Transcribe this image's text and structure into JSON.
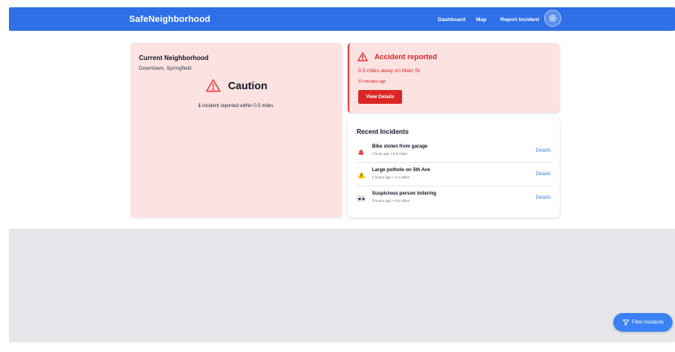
{
  "nav": {
    "brand": "SafeNeighborhood",
    "links": [
      {
        "label": "Dashboard"
      },
      {
        "label": "Map"
      },
      {
        "label": "Report Incident"
      }
    ],
    "avatar_icon": "settings-icon"
  },
  "neighborhood": {
    "title": "Current Neighborhood",
    "location": "Downtown, Springfield",
    "status_icon": "warning-triangle-icon",
    "status_label": "Caution",
    "summary_count": "1",
    "summary_text": " incident reported within 0.5 miles."
  },
  "alert": {
    "icon": "warning-triangle-icon",
    "title": "Accident reported",
    "distance": "0.5 miles away on Main St.",
    "time": "10 minutes ago",
    "button_label": "View Details"
  },
  "recent": {
    "title": "Recent Incidents",
    "items": [
      {
        "icon": "siren-icon",
        "title": "Bike stolen from garage",
        "meta": "1 hour ago • 0.8 miles",
        "link": "Details"
      },
      {
        "icon": "warning-icon",
        "title": "Large pothole on 5th Ave",
        "meta": "2 hours ago • 1.2 miles",
        "link": "Details"
      },
      {
        "icon": "eyes-icon",
        "title": "Suspicious person loitering",
        "meta": "3 hours ago • 0.5 miles",
        "link": "Details"
      }
    ]
  },
  "filter": {
    "icon": "filter-icon",
    "label": "Filter Incidents"
  },
  "colors": {
    "nav_bg": "#2f6fe8",
    "alert_red": "#dc2626",
    "card_pink": "#fde2e2",
    "link_blue": "#3b82f6",
    "map_gray": "#e5e7eb"
  }
}
